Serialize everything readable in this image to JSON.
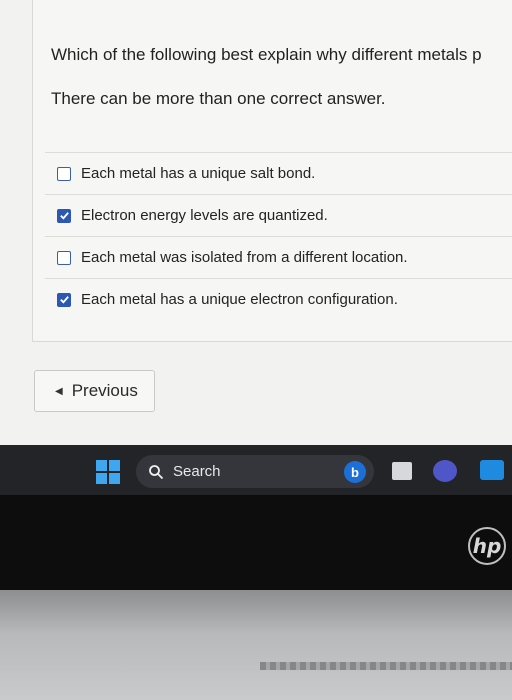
{
  "question": {
    "prompt": "Which of the following best explain why different metals p",
    "instruction": "There can be more than one correct answer."
  },
  "options": [
    {
      "label": "Each metal has a unique salt bond.",
      "checked": false
    },
    {
      "label": "Electron energy levels are quantized.",
      "checked": true
    },
    {
      "label": "Each metal was isolated from a different location.",
      "checked": false
    },
    {
      "label": "Each metal has a unique electron configuration.",
      "checked": true
    }
  ],
  "navigation": {
    "previous_label": "Previous"
  },
  "taskbar": {
    "search_label": "Search",
    "bing_glyph": "b",
    "icons": [
      "windows-start-icon",
      "search-icon",
      "bing-icon",
      "app-icon",
      "teams-icon",
      "mail-icon"
    ]
  },
  "device": {
    "logo_text": "hp"
  },
  "colors": {
    "checkbox_checked": "#2c58b3",
    "windows_blue": "#3ea7f0"
  }
}
